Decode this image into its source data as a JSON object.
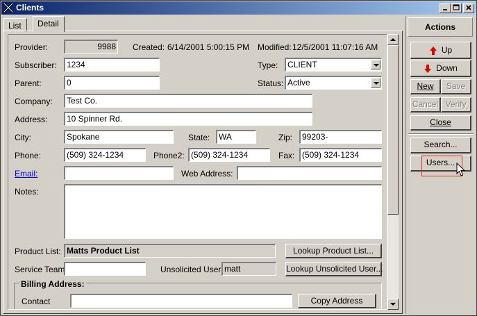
{
  "window": {
    "title": "Clients",
    "caption_buttons": [
      "_",
      "□",
      "×"
    ]
  },
  "tabs": [
    {
      "label": "List",
      "active": false
    },
    {
      "label": "Detail",
      "active": true
    }
  ],
  "form": {
    "provider": {
      "label": "Provider:",
      "value": "9988"
    },
    "created": {
      "label": "Created:",
      "value": "6/14/2001 5:00:15 PM"
    },
    "modified": {
      "label": "Modified:",
      "value": "12/5/2001 11:07:16 AM"
    },
    "subscriber": {
      "label": "Subscriber:",
      "value": "1234"
    },
    "type": {
      "label": "Type:",
      "value": "CLIENT"
    },
    "parent": {
      "label": "Parent:",
      "value": "0"
    },
    "status": {
      "label": "Status:",
      "value": "Active"
    },
    "company": {
      "label": "Company:",
      "value": "Test Co."
    },
    "address": {
      "label": "Address:",
      "value": "10 Spinner Rd."
    },
    "city": {
      "label": "City:",
      "value": "Spokane"
    },
    "state": {
      "label": "State:",
      "value": "WA"
    },
    "zip": {
      "label": "Zip:",
      "value": "99203-"
    },
    "phone": {
      "label": "Phone:",
      "value": "(509) 324-1234"
    },
    "phone2": {
      "label": "Phone2:",
      "value": "(509) 324-1234"
    },
    "fax": {
      "label": "Fax:",
      "value": "(509) 324-1234"
    },
    "email": {
      "label": "Email:",
      "value": ""
    },
    "web_address": {
      "label": "Web Address:",
      "value": ""
    },
    "notes": {
      "label": "Notes:",
      "value": ""
    },
    "product_list": {
      "label": "Product List:",
      "value": "Matts Product List",
      "button": "Lookup Product List..."
    },
    "service_team": {
      "label": "Service Team:",
      "value": ""
    },
    "unsolicited_user": {
      "label": "Unsolicited User:",
      "value": "matt",
      "button": "Lookup Unsolicited User..."
    },
    "billing": {
      "title": "Billing Address:",
      "contact_label": "Contact",
      "contact_value": "",
      "copy_button": "Copy Address"
    }
  },
  "actions": {
    "header": "Actions",
    "up": "Up",
    "down": "Down",
    "new": "New",
    "save": "Save",
    "cancel": "Cancel",
    "verify": "Verify",
    "close": "Close",
    "search": "Search...",
    "users": "Users..."
  },
  "colors": {
    "titlebar_start": "#0a246a",
    "titlebar_end": "#a6caf0",
    "highlight_box": "#e03030",
    "arrow_red": "#e00000"
  }
}
